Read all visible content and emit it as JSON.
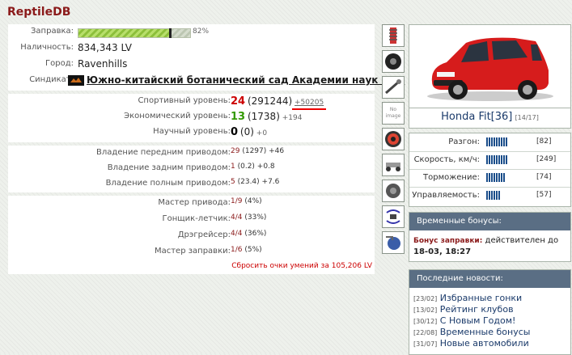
{
  "title": "ReptileDB",
  "info": {
    "fuel_label": "Заправка:",
    "fuel_percent": 82,
    "fuel_text": "82%",
    "cash_label": "Наличность:",
    "cash": "834,343 LV",
    "city_label": "Город:",
    "city": "Ravenhills",
    "syndicate_label": "Синдикат:",
    "syndicate": "Южно-китайский ботанический сад Академии наук КНР"
  },
  "levels": [
    {
      "label": "Спортивный уровень:",
      "level": "24",
      "points": "(291244)",
      "delta": "+50205"
    },
    {
      "label": "Экономический уровень:",
      "level": "13",
      "points": "(1738)",
      "delta": "+194"
    },
    {
      "label": "Научный уровень:",
      "level": "0",
      "points": "(0)",
      "delta": "+0"
    }
  ],
  "drives": [
    {
      "label": "Владение передним приводом:",
      "level": "29",
      "rest": "(1297) +46"
    },
    {
      "label": "Владение задним приводом:",
      "level": "1",
      "rest": "(0.2) +0.8"
    },
    {
      "label": "Владение полным приводом:",
      "level": "5",
      "rest": "(23.4) +7.6"
    }
  ],
  "skills": [
    {
      "label": "Мастер привода:",
      "level": "1/9",
      "rest": "(4%)"
    },
    {
      "label": "Гонщик-летчик:",
      "level": "4/4",
      "rest": "(33%)"
    },
    {
      "label": "Дрэгрейсер:",
      "level": "4/4",
      "rest": "(36%)"
    },
    {
      "label": "Мастер заправки:",
      "level": "1/6",
      "rest": "(5%)"
    }
  ],
  "reset_text": "Сбросить очки умений за 105,206 LV",
  "side_icons": [
    "suspension-icon",
    "tire-icon",
    "steering-icon",
    "no-image-icon",
    "brake-disc-icon",
    "chassis-icon",
    "engine-icon",
    "electronics-icon",
    "turbo-icon"
  ],
  "no_image_text": "No image",
  "car": {
    "name": "Honda Fit[36]",
    "level": "[14/17]",
    "stats": [
      {
        "label": "Разгон:",
        "value": "[82]",
        "segments": 9
      },
      {
        "label": "Скорость, км/ч:",
        "value": "[249]",
        "segments": 9
      },
      {
        "label": "Торможение:",
        "value": "[74]",
        "segments": 8
      },
      {
        "label": "Управляемость:",
        "value": "[57]",
        "segments": 6
      }
    ]
  },
  "bonuses": {
    "header": "Временные бонусы:",
    "name": "Бонус заправки:",
    "text": "действителен до",
    "date": "18-03, 18:27"
  },
  "news": {
    "header": "Последние новости:",
    "items": [
      {
        "date": "[23/02]",
        "text": "Избранные гонки"
      },
      {
        "date": "[13/02]",
        "text": "Рейтинг клубов"
      },
      {
        "date": "[30/12]",
        "text": "С Новым Годом!"
      },
      {
        "date": "[22/08]",
        "text": "Временные бонусы"
      },
      {
        "date": "[31/07]",
        "text": "Новые автомобили"
      }
    ]
  },
  "colors": {
    "accent_red": "#8b1a1a",
    "header_blue": "#5a6e84",
    "bar_blue": "#1a4d8a"
  }
}
